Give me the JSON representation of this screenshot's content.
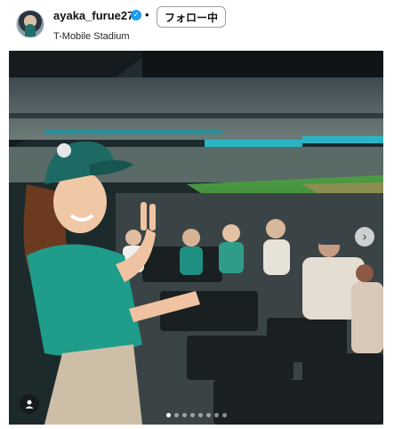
{
  "post": {
    "username": "ayaka_furue27",
    "location": "T-Mobile Stadium",
    "follow_label": "フォロー中",
    "separator": "•"
  },
  "icons": {
    "verified": "verified-badge-icon",
    "next": "chevron-right-icon",
    "tag": "user-tag-icon"
  },
  "carousel": {
    "total": 8,
    "current": 1
  },
  "colors": {
    "verified": "#1d9bf0",
    "jersey_teal": "#1f9c8a",
    "field_green": "#3f8a3b"
  }
}
